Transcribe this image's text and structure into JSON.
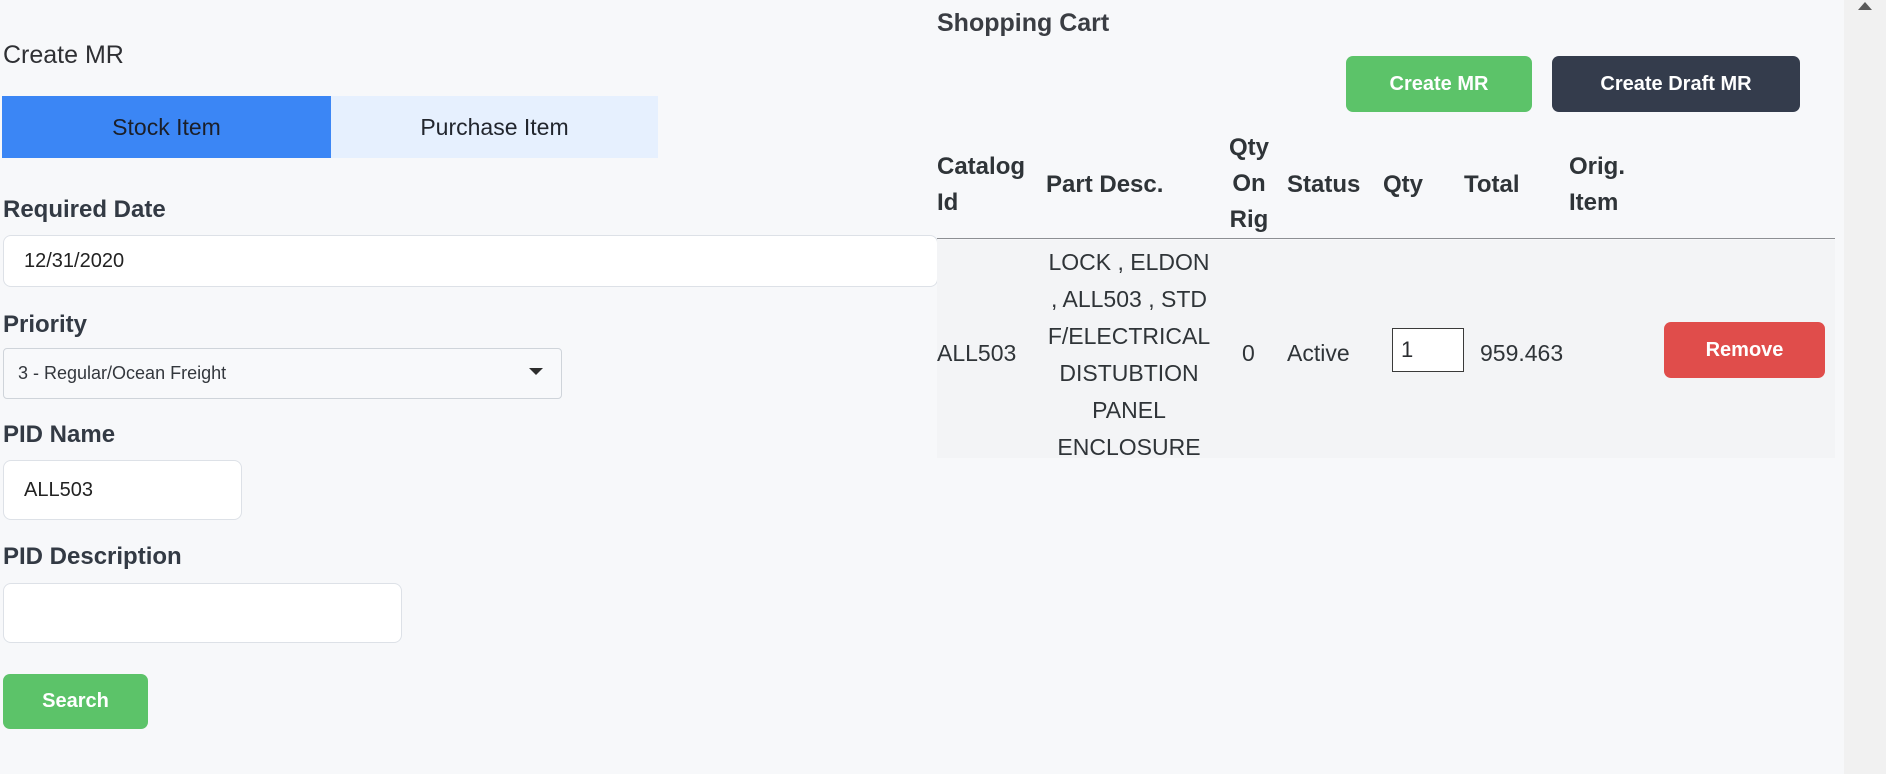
{
  "left": {
    "title": "Create MR",
    "tabs": [
      {
        "label": "Stock Item",
        "active": true
      },
      {
        "label": "Purchase Item",
        "active": false
      }
    ],
    "required_date": {
      "label": "Required Date",
      "value": "12/31/2020"
    },
    "priority": {
      "label": "Priority",
      "value": "3 - Regular/Ocean Freight"
    },
    "pid_name": {
      "label": "PID Name",
      "value": "ALL503"
    },
    "pid_description": {
      "label": "PID Description",
      "value": ""
    },
    "search_label": "Search"
  },
  "cart": {
    "title": "Shopping Cart",
    "create_mr_label": "Create MR",
    "create_draft_label": "Create Draft MR",
    "headers": {
      "catalog_id": [
        "Catalog",
        "Id"
      ],
      "part_desc": [
        "Part Desc."
      ],
      "qty_on_rig": [
        "Qty",
        "On",
        "Rig"
      ],
      "status": [
        "Status"
      ],
      "qty": [
        "Qty"
      ],
      "total": [
        "Total"
      ],
      "orig_item": [
        "Orig.",
        "Item"
      ]
    },
    "rows": [
      {
        "catalog_id": "ALL503",
        "part_desc_lines": [
          "LOCK , ELDON",
          ", ALL503 , STD",
          "F/ELECTRICAL",
          "DISTUBTION",
          "PANEL",
          "ENCLOSURE"
        ],
        "qty_on_rig": "0",
        "status": "Active",
        "qty": "1",
        "total": "959.463",
        "orig_item": "",
        "remove_label": "Remove"
      }
    ]
  },
  "colors": {
    "primary_blue": "#3b86f5",
    "success_green": "#5cc369",
    "dark_button": "#343c4c",
    "danger_red": "#e04d4b"
  },
  "icons": {
    "priority_dropdown": "chevron-down-icon",
    "scrollbar": "scroll-up-arrow-icon"
  }
}
